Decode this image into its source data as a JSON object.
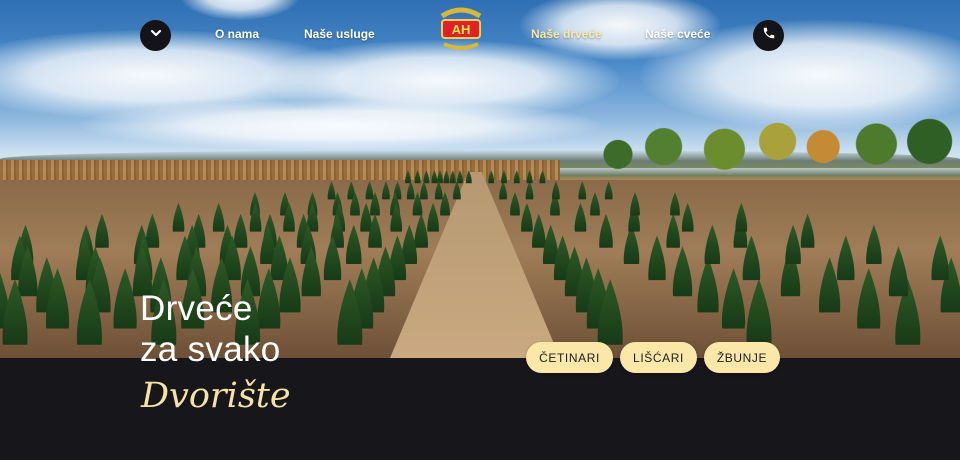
{
  "nav": {
    "left_items": [
      {
        "label": "O nama"
      },
      {
        "label": "Naše usluge"
      }
    ],
    "right_items": [
      {
        "label": "Naše drveće",
        "active": true
      },
      {
        "label": "Naše cveće"
      }
    ],
    "menu_icon": "chevron-down-icon",
    "phone_icon": "phone-icon",
    "logo_text": "AH"
  },
  "hero": {
    "headline_line1": "Drveće",
    "headline_line2": "za svako",
    "headline_script": "Dvorište"
  },
  "categories": [
    {
      "label": "ČETINARI"
    },
    {
      "label": "LIŠĆARI"
    },
    {
      "label": "ŽBUNJE"
    }
  ],
  "colors": {
    "accent": "#fbe8a9",
    "active_link": "#f7e9a8",
    "script_text": "#f4e2a6",
    "dark_band": "#17161b",
    "circle_button": "#141317"
  }
}
